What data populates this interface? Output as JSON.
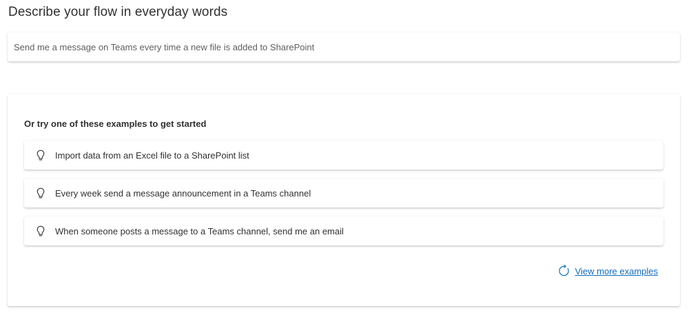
{
  "header": {
    "title": "Describe your flow in everyday words"
  },
  "prompt": {
    "value": "Send me a message on Teams every time a new file is added to SharePoint"
  },
  "examples": {
    "heading": "Or try one of these examples to get started",
    "items": [
      {
        "label": "Import data from an Excel file to a SharePoint list",
        "icon": "lightbulb-icon"
      },
      {
        "label": "Every week send a message announcement in a Teams channel",
        "icon": "lightbulb-icon"
      },
      {
        "label": "When someone posts a message to a Teams channel, send me an email",
        "icon": "lightbulb-icon"
      }
    ],
    "view_more_label": "View more examples",
    "view_more_icon": "refresh-icon"
  },
  "colors": {
    "link": "#0f6cbd",
    "text": "#323130"
  }
}
